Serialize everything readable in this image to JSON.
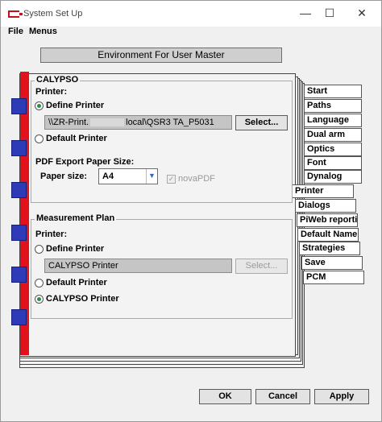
{
  "window": {
    "title": "System Set Up",
    "minimize": "—",
    "maximize": "☐",
    "close": "✕"
  },
  "menu": {
    "file": "File",
    "menus": "Menus"
  },
  "header": "Environment For User Master",
  "calypso": {
    "title": "CALYPSO",
    "printer_label": "Printer:",
    "define_printer": "Define Printer",
    "printer_prefix": "\\\\ZR-Print.",
    "printer_suffix": "local\\QSR3 TA_P5031",
    "select_button": "Select...",
    "default_printer": "Default Printer",
    "pdf_label": "PDF Export Paper Size:",
    "paper_size_label": "Paper size:",
    "paper_size_value": "A4",
    "novapdf": "novaPDF"
  },
  "measurement": {
    "title": "Measurement Plan",
    "printer_label": "Printer:",
    "define_printer": "Define Printer",
    "printer_value": "CALYPSO Printer",
    "select_button": "Select...",
    "default_printer": "Default Printer",
    "calypso_printer": "CALYPSO Printer"
  },
  "tabs": [
    "Start",
    "Paths",
    "Language",
    "Dual arm",
    "Optics",
    "Font",
    "Dynalog",
    "Printer",
    "Dialogs",
    "PiWeb reportin",
    "Default Name",
    "Strategies",
    "Save",
    "PCM"
  ],
  "buttons": {
    "ok": "OK",
    "cancel": "Cancel",
    "apply": "Apply"
  }
}
